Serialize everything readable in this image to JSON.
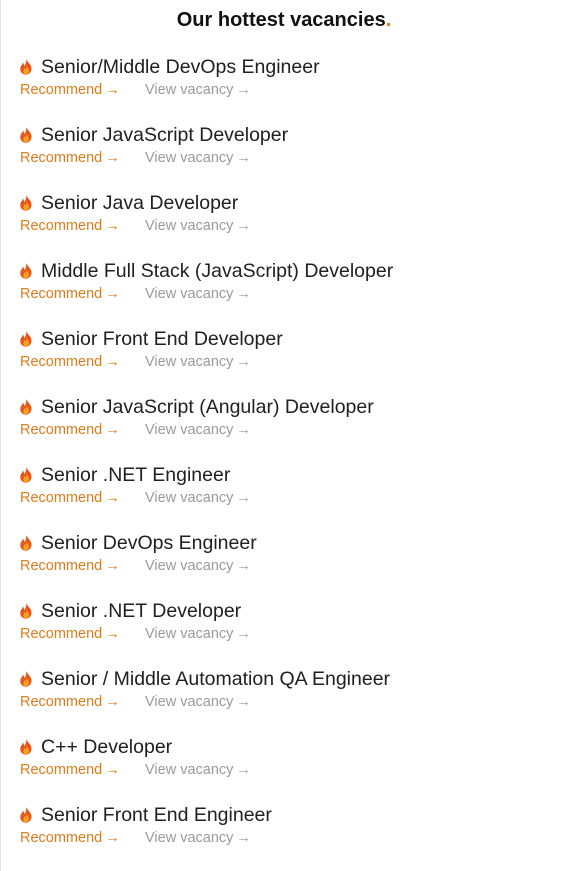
{
  "header": {
    "title": "Our hottest vacancies",
    "dot": "."
  },
  "colors": {
    "accent": "#e07b1a",
    "muted": "#9a9a9a"
  },
  "vacancies": [
    {
      "title": "Senior/Middle DevOps Engineer",
      "recommend": "Recommend",
      "view": "View vacancy",
      "arrow": "→"
    },
    {
      "title": "Senior JavaScript Developer",
      "recommend": "Recommend",
      "view": "View vacancy",
      "arrow": "→"
    },
    {
      "title": "Senior Java Developer",
      "recommend": "Recommend",
      "view": "View vacancy",
      "arrow": "→"
    },
    {
      "title": "Middle Full Stack (JavaScript) Developer",
      "recommend": "Recommend",
      "view": "View vacancy",
      "arrow": "→"
    },
    {
      "title": "Senior Front End Developer",
      "recommend": "Recommend",
      "view": "View vacancy",
      "arrow": "→"
    },
    {
      "title": "Senior JavaScript (Angular) Developer",
      "recommend": "Recommend",
      "view": "View vacancy",
      "arrow": "→"
    },
    {
      "title": "Senior .NET Engineer",
      "recommend": "Recommend",
      "view": "View vacancy",
      "arrow": "→"
    },
    {
      "title": "Senior DevOps Engineer",
      "recommend": "Recommend",
      "view": "View vacancy",
      "arrow": "→"
    },
    {
      "title": "Senior .NET Developer",
      "recommend": "Recommend",
      "view": "View vacancy",
      "arrow": "→"
    },
    {
      "title": "Senior / Middle Automation QA Engineer",
      "recommend": "Recommend",
      "view": "View vacancy",
      "arrow": "→"
    },
    {
      "title": "C++ Developer",
      "recommend": "Recommend",
      "view": "View vacancy",
      "arrow": "→"
    },
    {
      "title": "Senior Front End Engineer",
      "recommend": "Recommend",
      "view": "View vacancy",
      "arrow": "→"
    }
  ]
}
